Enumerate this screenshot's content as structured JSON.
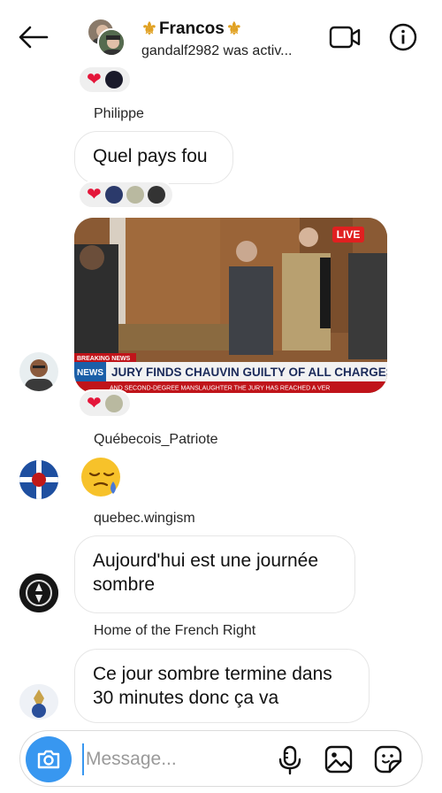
{
  "header": {
    "title": "Francos",
    "title_decoration": "⚜",
    "subtitle": "gandalf2982 was activ..."
  },
  "messages": [
    {
      "sender": "Philippe",
      "text": "Quel pays fou"
    },
    {
      "type": "video",
      "live_badge": "LIVE",
      "chyron": "JURY FINDS CHAUVIN GUILTY OF ALL CHARGES",
      "breaking": "BREAKING NEWS",
      "ticker": "AND SECOND-DEGREE MANSLAUGHTER   THE JURY HAS REACHED A VER",
      "channel": "NEWS",
      "channel_num": "19"
    },
    {
      "sender": "Québecois_Patriote",
      "emoji": "😪"
    },
    {
      "sender": "quebec.wingism",
      "text_line1": "Aujourd'hui est une journée",
      "text_line2": "sombre"
    },
    {
      "sender": "Home of the French Right",
      "text_line1": "Ce jour sombre termine dans",
      "text_line2": "30 minutes donc ça va"
    }
  ],
  "composer": {
    "placeholder": "Message..."
  },
  "colors": {
    "accent": "#3897f0",
    "heart": "#e4163a",
    "live": "#e02020"
  },
  "icons": [
    "back-arrow-icon",
    "video-call-icon",
    "info-icon",
    "heart-icon",
    "camera-icon",
    "microphone-icon",
    "gallery-icon",
    "sticker-icon"
  ]
}
